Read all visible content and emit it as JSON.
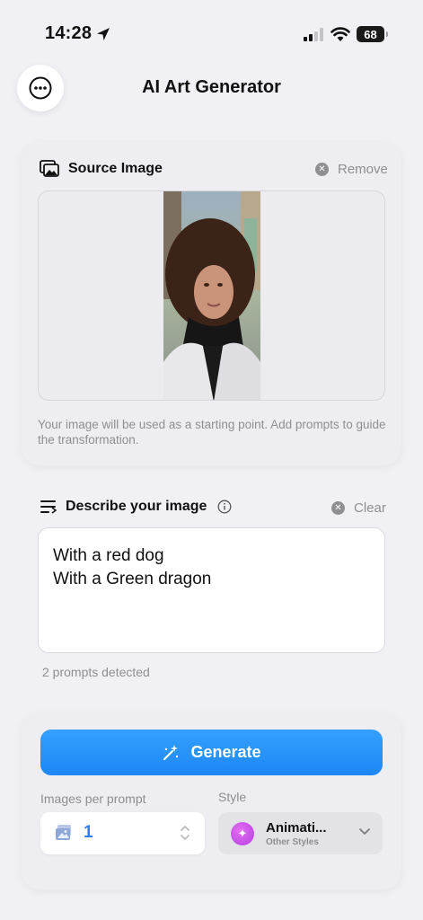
{
  "status_bar": {
    "time": "14:28",
    "battery": "68"
  },
  "header": {
    "title": "AI Art Generator",
    "menu_icon": "ellipsis-circle-icon"
  },
  "source": {
    "title": "Source Image",
    "remove_label": "Remove",
    "helper": "Your image will be used as a starting point. Add prompts to guide the transformation."
  },
  "describe": {
    "title": "Describe your image",
    "clear_label": "Clear",
    "prompts": [
      "With a red dog",
      "With a Green dragon"
    ],
    "count_text": "2 prompts detected"
  },
  "generate": {
    "button_label": "Generate",
    "images_label": "Images per prompt",
    "images_value": "1",
    "style_label": "Style",
    "style_name": "Animati...",
    "style_sub": "Other Styles"
  },
  "colors": {
    "accent": "#1c87f4",
    "background": "#f1f1f5",
    "style_dot": "#c84fe8",
    "muted_text": "#8e8e93"
  }
}
